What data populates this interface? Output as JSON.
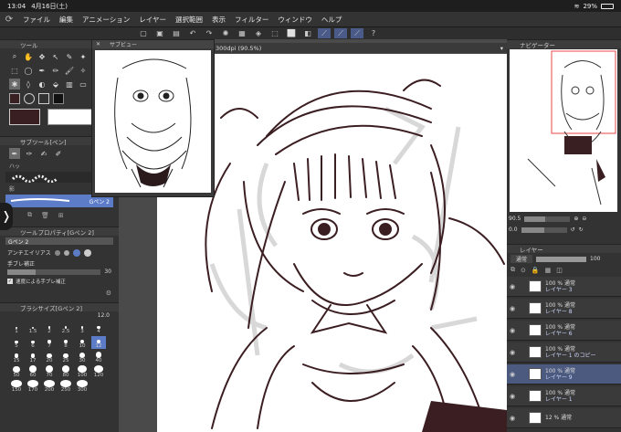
{
  "status": {
    "time": "13:04",
    "date": "4月16日(土)",
    "battery": "29%"
  },
  "menu": [
    "ファイル",
    "編集",
    "アニメーション",
    "レイヤー",
    "選択範囲",
    "表示",
    "フィルター",
    "ウィンドウ",
    "ヘルプ"
  ],
  "canvas": {
    "tab_label": "300dpi (90.5%)"
  },
  "subview": {
    "title": "サブビュー",
    "close": "✕"
  },
  "tool_panel": {
    "title": "ツール"
  },
  "subtool": {
    "title": "サブツール[ペン]",
    "tab1": "ペン",
    "tab2": "ハッ",
    "pen_name": "ペン",
    "item_label": "Gペン 2",
    "ho": "HO",
    "shadow": "影"
  },
  "toolprop": {
    "title": "ツールプロパティ[Gペン 2]",
    "brush": "Gペン 2",
    "antialias": "アンチエイリアス",
    "stabilization": "手ブレ補正",
    "stab_value": "30",
    "speed_stab": "速度による手ブレ補正"
  },
  "brushsize": {
    "title": "ブラシサイズ[Gペン 2]",
    "value": "12.0",
    "sizes": [
      "1",
      "1.5",
      "2",
      "2.5",
      "3",
      "4",
      "5",
      "6",
      "7",
      "8",
      "10",
      "12",
      "15",
      "17",
      "20",
      "25",
      "30",
      "40",
      "50",
      "60",
      "70",
      "80",
      "100",
      "120",
      "150",
      "170",
      "200",
      "250",
      "300"
    ]
  },
  "navigator": {
    "title": "ナビゲーター",
    "zoom": "90.5",
    "angle": "0.0"
  },
  "layer_panel": {
    "title": "レイヤー",
    "blend": "通常",
    "opacity": "100"
  },
  "layers": [
    {
      "line1": "100 % 通常",
      "name": "レイヤー 3"
    },
    {
      "line1": "100 % 通常",
      "name": "レイヤー 8"
    },
    {
      "line1": "100 % 通常",
      "name": "レイヤー 6"
    },
    {
      "line1": "100 % 通常",
      "name": "レイヤー 1 のコピー"
    },
    {
      "line1": "100 % 通常",
      "name": "レイヤー 9"
    },
    {
      "line1": "100 % 通常",
      "name": "レイヤー 1"
    },
    {
      "line1": "12 % 通常",
      "name": ""
    }
  ],
  "colors": {
    "main_color": "#3a1f22",
    "sub_color": "#ffffff",
    "accent": "#5d7cc7",
    "line": "#3b1e22"
  }
}
